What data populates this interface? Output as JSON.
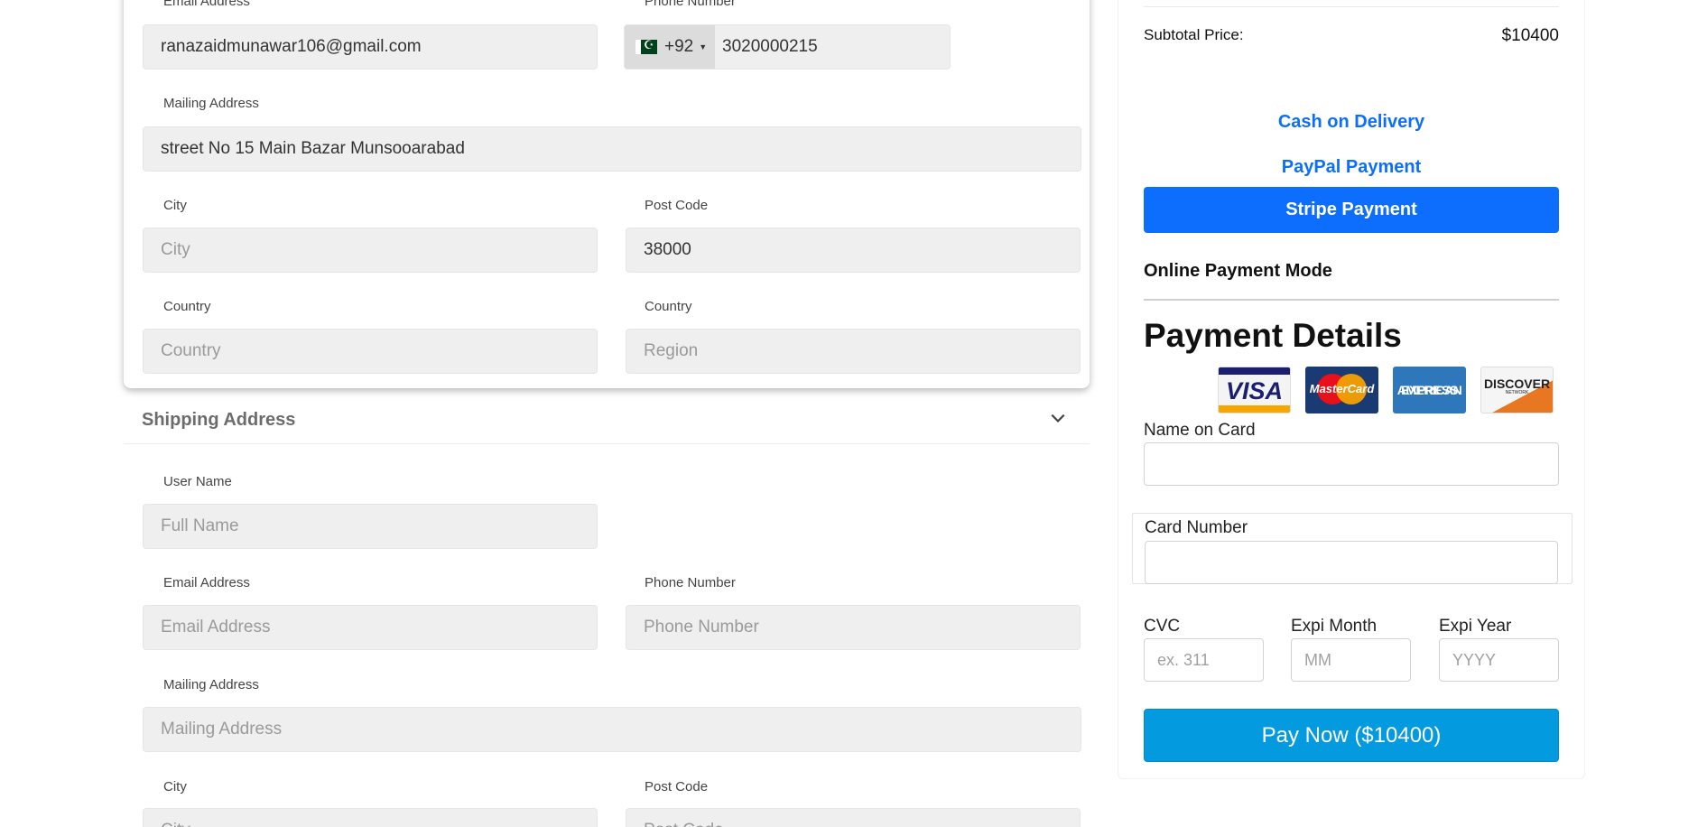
{
  "billing": {
    "email_label": "Email Address",
    "email_value": "ranazaidmunawar106@gmail.com",
    "phone_label": "Phone Number",
    "phone_country_code": "+92",
    "phone_value": "3020000215",
    "mailing_label": "Mailing Address",
    "mailing_value": "street No 15 Main Bazar Munsooarabad",
    "city_label": "City",
    "city_placeholder": "City",
    "postcode_label": "Post Code",
    "postcode_value": "38000",
    "country_label": "Country",
    "country_placeholder": "Country",
    "region_label": "Country",
    "region_placeholder": "Region"
  },
  "shipping": {
    "title": "Shipping Address",
    "username_label": "User Name",
    "username_placeholder": "Full Name",
    "email_label": "Email Address",
    "email_placeholder": "Email Address",
    "phone_label": "Phone Number",
    "phone_placeholder": "Phone Number",
    "mailing_label": "Mailing Address",
    "mailing_placeholder": "Mailing Address",
    "city_label": "City",
    "city_placeholder": "City",
    "postcode_label": "Post Code",
    "postcode_placeholder": "Post Code"
  },
  "summary": {
    "subtotal_label": "Subtotal Price:",
    "subtotal_value": "$10400",
    "cod_label": "Cash on Delivery",
    "paypal_label": "PayPal Payment",
    "stripe_label": "Stripe Payment",
    "mode_label": "Online Payment Mode",
    "details_title": "Payment Details",
    "cards": {
      "visa": "VISA",
      "mastercard": "MasterCard",
      "amex_line1": "AMERICAN",
      "amex_line2": "EXPRESS",
      "discover": "DISCOVER",
      "discover_sub": "NETWORK"
    },
    "name_on_card_label": "Name on Card",
    "card_number_label": "Card Number",
    "cvc_label": "CVC",
    "cvc_placeholder": "ex. 311",
    "exp_month_label": "Expi Month",
    "exp_month_placeholder": "MM",
    "exp_year_label": "Expi Year",
    "exp_year_placeholder": "YYYY",
    "pay_now_label": "Pay Now ($10400)"
  },
  "colors": {
    "accent": "#0d6efd",
    "pay_button": "#039ae0",
    "field_bg": "#efefef"
  }
}
